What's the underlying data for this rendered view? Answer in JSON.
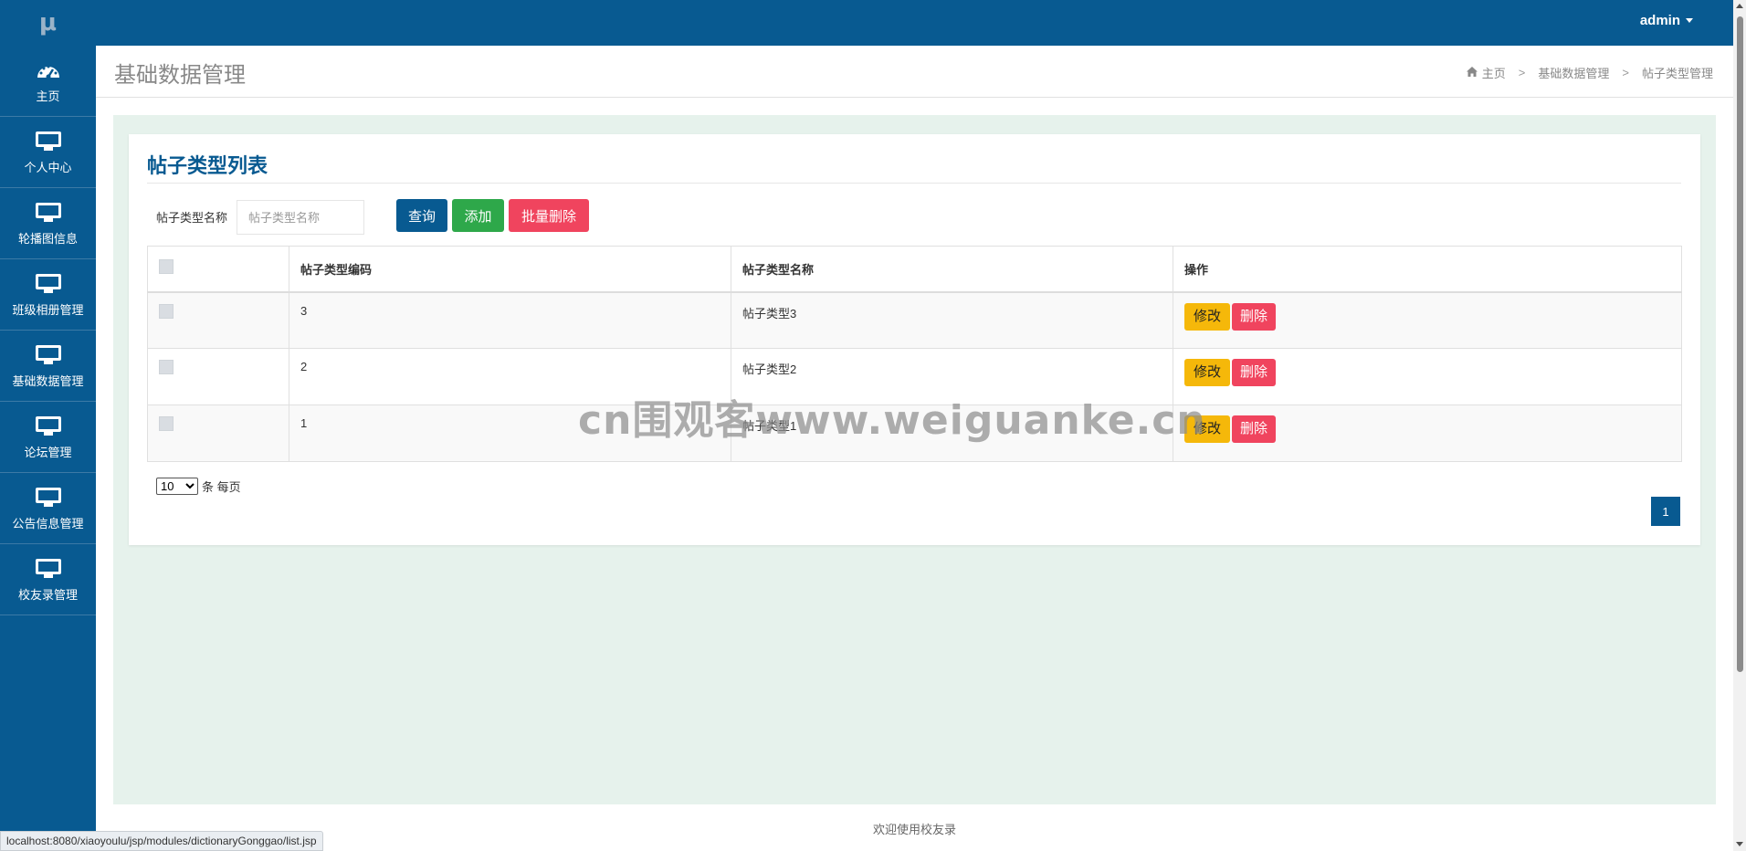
{
  "brand": {
    "logo": "μ"
  },
  "topbar": {
    "user": "admin"
  },
  "sidebar": {
    "items": [
      {
        "label": "主页",
        "icon": "dashboard-icon"
      },
      {
        "label": "个人中心",
        "icon": "monitor-icon"
      },
      {
        "label": "轮播图信息",
        "icon": "monitor-icon"
      },
      {
        "label": "班级相册管理",
        "icon": "monitor-icon"
      },
      {
        "label": "基础数据管理",
        "icon": "monitor-icon"
      },
      {
        "label": "论坛管理",
        "icon": "monitor-icon"
      },
      {
        "label": "公告信息管理",
        "icon": "monitor-icon"
      },
      {
        "label": "校友录管理",
        "icon": "monitor-icon"
      }
    ]
  },
  "header": {
    "title": "基础数据管理",
    "breadcrumb": [
      "主页",
      "基础数据管理",
      "帖子类型管理"
    ]
  },
  "panel": {
    "title": "帖子类型列表",
    "search": {
      "label": "帖子类型名称",
      "placeholder": "帖子类型名称",
      "value": ""
    },
    "buttons": {
      "query": "查询",
      "add": "添加",
      "batch_delete": "批量删除"
    },
    "table": {
      "headers": [
        "",
        "帖子类型编码",
        "帖子类型名称",
        "操作"
      ],
      "rows": [
        {
          "code": "3",
          "name": "帖子类型3"
        },
        {
          "code": "2",
          "name": "帖子类型2"
        },
        {
          "code": "1",
          "name": "帖子类型1"
        }
      ],
      "actions": {
        "edit": "修改",
        "delete": "删除"
      }
    },
    "page_size": {
      "selected": "10",
      "options": [
        "10"
      ],
      "suffix": "条 每页"
    },
    "pagination": {
      "current": "1"
    }
  },
  "footer": {
    "text": "欢迎使用校友录"
  },
  "watermark": "cn围观客www.weiguanke.cn",
  "statusbar": {
    "url": "localhost:8080/xiaoyoulu/jsp/modules/dictionaryGonggao/list.jsp"
  },
  "colors": {
    "primary": "#085a91",
    "success": "#2ea84a",
    "danger": "#f0445e",
    "warning": "#f5b80a",
    "content_bg": "#e6f2ec"
  }
}
